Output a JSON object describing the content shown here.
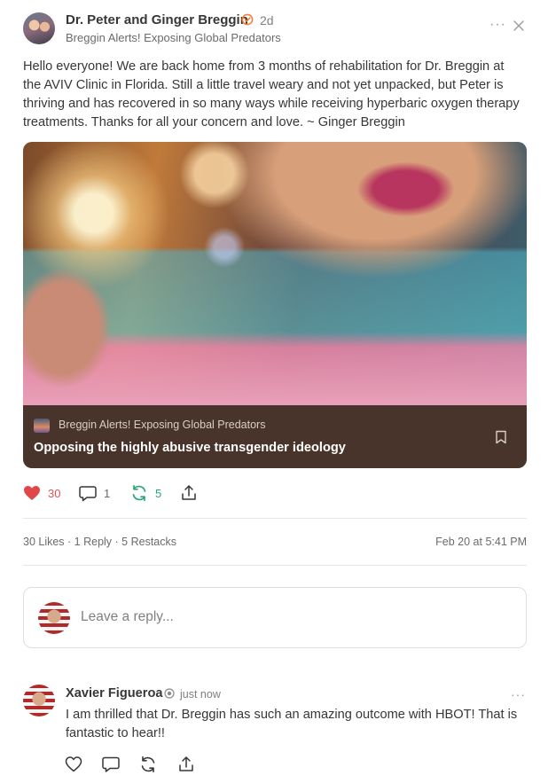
{
  "post": {
    "author": "Dr. Peter and Ginger Breggin",
    "time": "2d",
    "publication": "Breggin Alerts! Exposing Global Predators",
    "body": "Hello everyone!  We are back home from 3 months of rehabilitation for Dr. Breggin at the AVIV Clinic in Florida.  Still a little travel weary and not yet unpacked, but Peter is thriving and has recovered in so many ways while receiving hyperbaric oxygen therapy treatments.  Thanks for all your concern and love.  ~ Ginger Breggin"
  },
  "card": {
    "publication": "Breggin Alerts! Exposing Global Predators",
    "title": "Opposing the highly abusive transgender ideology"
  },
  "actions": {
    "likes": "30",
    "comments": "1",
    "restacks": "5"
  },
  "stats": {
    "likes": "30 Likes",
    "replies": "1 Reply",
    "restacks": "5 Restacks",
    "sep": " · ",
    "date": "Feb 20 at 5:41 PM"
  },
  "reply": {
    "placeholder": "Leave a reply..."
  },
  "comment": {
    "author": "Xavier Figueroa",
    "time": "just now",
    "text": "I am thrilled that Dr. Breggin has such an amazing outcome with HBOT!  That is fantastic to hear!!"
  },
  "icons": {
    "verified": "verified-check-icon",
    "more": "more-dots-icon",
    "close": "close-icon",
    "bookmark": "bookmark-icon",
    "heart": "heart-icon",
    "comment": "comment-bubble-icon",
    "restack": "restack-icon",
    "share": "share-icon"
  },
  "colors": {
    "like_active": "#e04848",
    "restack_active": "#2aa776",
    "verified": "#f0803c",
    "card_footer": "#48342a"
  }
}
